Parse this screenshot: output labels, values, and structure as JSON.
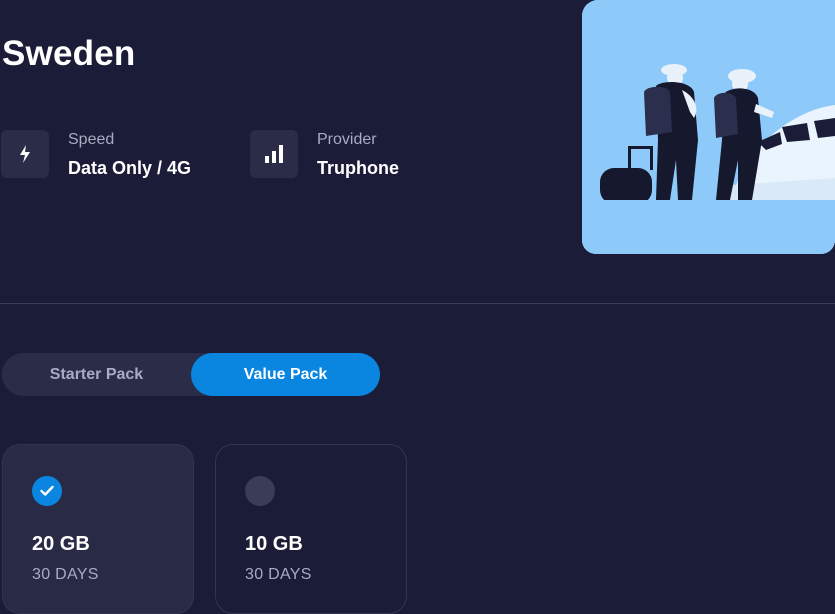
{
  "country": {
    "name": "Sweden"
  },
  "info": {
    "speed": {
      "label": "Speed",
      "value": "Data Only / 4G",
      "icon": "lightning-icon"
    },
    "provider": {
      "label": "Provider",
      "value": "Truphone",
      "icon": "signal-bars-icon"
    }
  },
  "hero": {
    "icon": "travelers-airplane-illustration"
  },
  "tabs": [
    {
      "label": "Starter Pack",
      "active": false
    },
    {
      "label": "Value Pack",
      "active": true
    }
  ],
  "plans": [
    {
      "data": "20 GB",
      "duration": "30 DAYS",
      "selected": true
    },
    {
      "data": "10 GB",
      "duration": "30 DAYS",
      "selected": false
    }
  ],
  "colors": {
    "background": "#1b1d38",
    "accent": "#0a85e0",
    "surface": "#2a2c48",
    "muted_text": "#a9abc1",
    "hero_sky": "#8dcaf9"
  }
}
